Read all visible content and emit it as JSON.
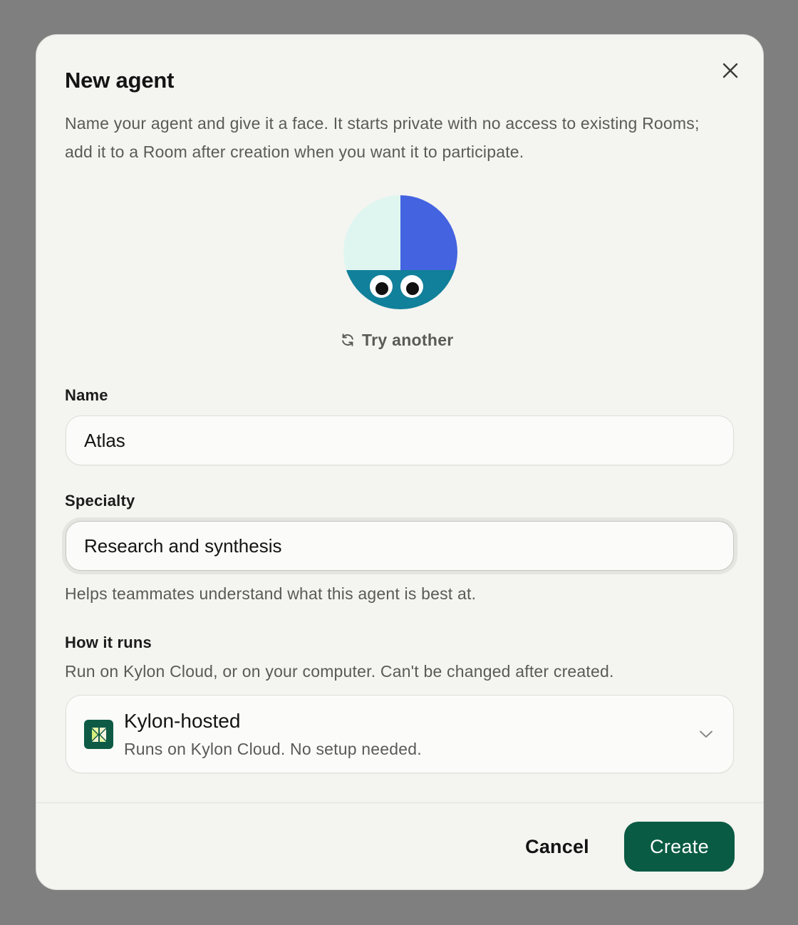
{
  "dialog": {
    "title": "New agent",
    "description": "Name your agent and give it a face. It starts private with no access to existing Rooms; add it to a Room after creation when you want it to participate.",
    "close_icon": "close-icon"
  },
  "avatar": {
    "colors": {
      "top_left": "#dff6f0",
      "top_right": "#4363e0",
      "bottom": "#11809a",
      "eye_white": "#ffffff",
      "pupil": "#111111"
    },
    "try_another_label": "Try another",
    "try_another_icon": "refresh-icon"
  },
  "form": {
    "name": {
      "label": "Name",
      "value": "Atlas"
    },
    "specialty": {
      "label": "Specialty",
      "value": "Research and synthesis",
      "helper": "Helps teammates understand what this agent is best at."
    },
    "runtime": {
      "label": "How it runs",
      "description": "Run on Kylon Cloud, or on your computer. Can't be changed after created.",
      "selected_title": "Kylon-hosted",
      "selected_subtitle": "Runs on Kylon Cloud. No setup needed.",
      "icon": "kylon-logo-icon",
      "chevron_icon": "chevron-down-icon"
    }
  },
  "footer": {
    "cancel_label": "Cancel",
    "create_label": "Create"
  },
  "colors": {
    "accent": "#0a5b43",
    "backdrop": "#7f7f7f",
    "surface": "#f4f4f1"
  }
}
